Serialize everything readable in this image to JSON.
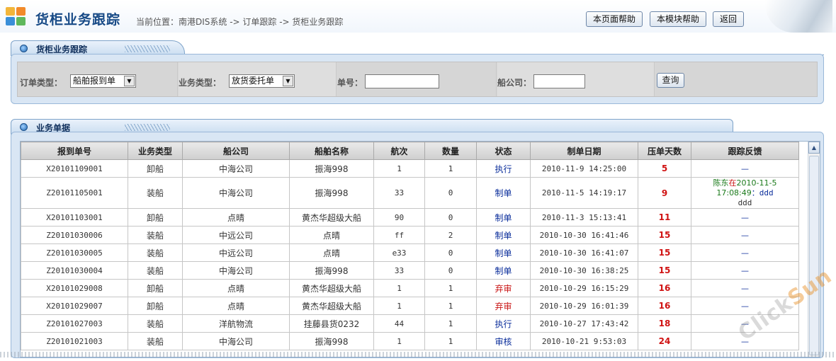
{
  "header": {
    "title": "货柜业务跟踪",
    "breadcrumb": "当前位置：南港DIS系统 -> 订单跟踪 -> 货柜业务跟踪",
    "buttons": {
      "page_help": "本页面帮助",
      "module_help": "本模块帮助",
      "back": "返回"
    }
  },
  "search": {
    "tab_title": "货柜业务跟踪",
    "order_type_label": "订单类型：",
    "order_type_value": "船舶报到单",
    "biz_type_label": "业务类型：",
    "biz_type_value": "放货委托单",
    "order_no_label": "单号：",
    "order_no_value": "",
    "shipping_co_label": "船公司：",
    "shipping_co_value": "",
    "query_button": "查询"
  },
  "list": {
    "tab_title": "业务单据",
    "columns": [
      "报到单号",
      "业务类型",
      "船公司",
      "船舶名称",
      "航次",
      "数量",
      "状态",
      "制单日期",
      "压单天数",
      "跟踪反馈"
    ],
    "rows": [
      {
        "no": "X20101109001",
        "type": "卸船",
        "company": "中海公司",
        "ship": "振海998",
        "voyage": "1",
        "qty": "1",
        "status": "执行",
        "status_color": "blue",
        "date": "2010-11-9 14:25:00",
        "days": "5",
        "feedback": "—"
      },
      {
        "no": "Z20101105001",
        "type": "装船",
        "company": "中海公司",
        "ship": "振海998",
        "voyage": "33",
        "qty": "0",
        "status": "制单",
        "status_color": "blue",
        "date": "2010-11-5 14:19:17",
        "days": "9",
        "feedback": "",
        "feedback_rich": {
          "who": "陈东",
          "at": "在",
          "date1": "2010-11-5",
          "date2": "17:08:49",
          "sep": "：",
          "msg": "ddd",
          "msg2": "ddd"
        }
      },
      {
        "no": "X20101103001",
        "type": "卸船",
        "company": "点晴",
        "ship": "黄杰华超级大船",
        "voyage": "90",
        "qty": "0",
        "status": "制单",
        "status_color": "blue",
        "date": "2010-11-3 15:13:41",
        "days": "11",
        "feedback": "—"
      },
      {
        "no": "Z20101030006",
        "type": "装船",
        "company": "中远公司",
        "ship": "点晴",
        "voyage": "ff",
        "qty": "2",
        "status": "制单",
        "status_color": "blue",
        "date": "2010-10-30 16:41:46",
        "days": "15",
        "feedback": "—"
      },
      {
        "no": "Z20101030005",
        "type": "装船",
        "company": "中远公司",
        "ship": "点晴",
        "voyage": "e33",
        "qty": "0",
        "status": "制单",
        "status_color": "blue",
        "date": "2010-10-30 16:41:07",
        "days": "15",
        "feedback": "—"
      },
      {
        "no": "Z20101030004",
        "type": "装船",
        "company": "中海公司",
        "ship": "振海998",
        "voyage": "33",
        "qty": "0",
        "status": "制单",
        "status_color": "blue",
        "date": "2010-10-30 16:38:25",
        "days": "15",
        "feedback": "—"
      },
      {
        "no": "X20101029008",
        "type": "卸船",
        "company": "点晴",
        "ship": "黄杰华超级大船",
        "voyage": "1",
        "qty": "1",
        "status": "弃审",
        "status_color": "red",
        "date": "2010-10-29 16:15:29",
        "days": "16",
        "feedback": "—"
      },
      {
        "no": "X20101029007",
        "type": "卸船",
        "company": "点晴",
        "ship": "黄杰华超级大船",
        "voyage": "1",
        "qty": "1",
        "status": "弃审",
        "status_color": "red",
        "date": "2010-10-29 16:01:39",
        "days": "16",
        "feedback": "—"
      },
      {
        "no": "Z20101027003",
        "type": "装船",
        "company": "洋航物流",
        "ship": "挂藤县货0232",
        "voyage": "44",
        "qty": "1",
        "status": "执行",
        "status_color": "blue",
        "date": "2010-10-27 17:43:42",
        "days": "18",
        "feedback": "—"
      },
      {
        "no": "Z20101021003",
        "type": "装船",
        "company": "中海公司",
        "ship": "振海998",
        "voyage": "1",
        "qty": "1",
        "status": "审核",
        "status_color": "blue",
        "date": "2010-10-21 9:53:03",
        "days": "24",
        "feedback": "—"
      }
    ]
  },
  "watermark": {
    "text_a": "Click",
    "text_b": "Sun"
  },
  "colors": {
    "brand": "#174a86",
    "status_blue": "#0b2e9b",
    "status_red": "#c91515",
    "days_red": "#d01212"
  },
  "icons": {
    "logo": "app-logo-icon",
    "tab_bullet": "tab-bullet-icon",
    "select_arrow": "dropdown-arrow-icon",
    "scroll_up": "scroll-up-arrow-icon"
  }
}
